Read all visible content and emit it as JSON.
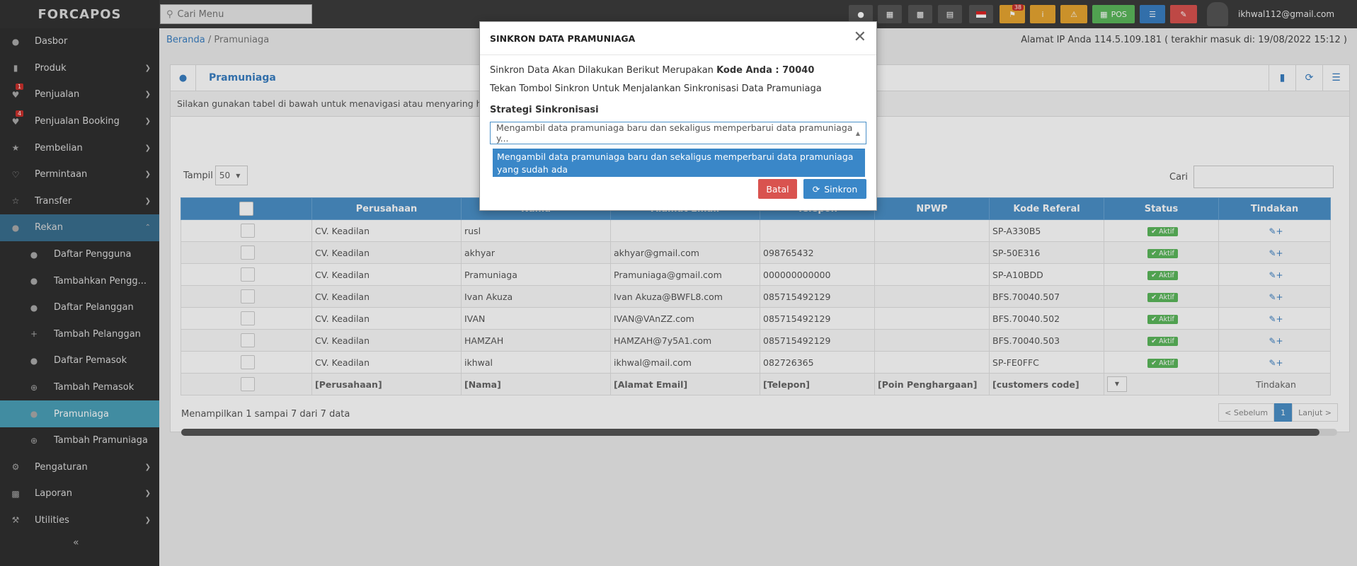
{
  "app": {
    "logo": "FORCAPOS",
    "search_placeholder": "Cari Menu",
    "user": "ikhwal112@gmail.com"
  },
  "toolbar": {
    "pos_label": "POS",
    "notif_count": "38"
  },
  "sidebar": {
    "items": [
      {
        "label": "Dasbor",
        "icon": "dashboard-icon"
      },
      {
        "label": "Produk",
        "icon": "barcode-icon"
      },
      {
        "label": "Penjualan",
        "icon": "heart-icon",
        "badge": "1"
      },
      {
        "label": "Penjualan Booking",
        "icon": "heart-icon",
        "badge": "4"
      },
      {
        "label": "Pembelian",
        "icon": "star-icon"
      },
      {
        "label": "Permintaan",
        "icon": "heart-outline-icon"
      },
      {
        "label": "Transfer",
        "icon": "star-outline-icon"
      },
      {
        "label": "Rekan",
        "icon": "users-icon"
      },
      {
        "label": "Daftar Pengguna",
        "icon": "users-icon"
      },
      {
        "label": "Tambahkan Pengg...",
        "icon": "user-plus-icon"
      },
      {
        "label": "Daftar Pelanggan",
        "icon": "users-icon"
      },
      {
        "label": "Tambah Pelanggan",
        "icon": "plus-icon"
      },
      {
        "label": "Daftar Pemasok",
        "icon": "users-icon"
      },
      {
        "label": "Tambah Pemasok",
        "icon": "plus-circle-icon"
      },
      {
        "label": "Pramuniaga",
        "icon": "users-icon"
      },
      {
        "label": "Tambah Pramuniaga",
        "icon": "plus-circle-icon"
      },
      {
        "label": "Pengaturan",
        "icon": "gear-icon"
      },
      {
        "label": "Laporan",
        "icon": "bar-chart-icon"
      },
      {
        "label": "Utilities",
        "icon": "wrench-icon"
      }
    ]
  },
  "breadcrumb": {
    "home": "Beranda",
    "current": "Pramuniaga"
  },
  "ip_info": "Alamat IP Anda 114.5.109.181 ( terakhir masuk di: 19/08/2022 15:12 )",
  "panel": {
    "title": "Pramuniaga",
    "hint": "Silakan gunakan tabel di bawah untuk menavigasi atau menyaring hasil.",
    "show_label": "Tampil",
    "show_value": "50",
    "search_label": "Cari"
  },
  "table": {
    "headers": [
      "Perusahaan",
      "Nama",
      "Alamat Email",
      "Telepon",
      "NPWP",
      "Kode Referal",
      "Status",
      "Tindakan"
    ],
    "rows": [
      [
        "CV. Keadilan",
        "rusl",
        "",
        "",
        "",
        "SP-A330B5",
        "Aktif"
      ],
      [
        "CV. Keadilan",
        "akhyar",
        "akhyar@gmail.com",
        "098765432",
        "",
        "SP-50E316",
        "Aktif"
      ],
      [
        "CV. Keadilan",
        "Pramuniaga",
        "Pramuniaga@gmail.com",
        "000000000000",
        "",
        "SP-A10BDD",
        "Aktif"
      ],
      [
        "CV. Keadilan",
        "Ivan Akuza",
        "Ivan Akuza@BWFL8.com",
        "085715492129",
        "",
        "BFS.70040.507",
        "Aktif"
      ],
      [
        "CV. Keadilan",
        "IVAN",
        "IVAN@VAnZZ.com",
        "085715492129",
        "",
        "BFS.70040.502",
        "Aktif"
      ],
      [
        "CV. Keadilan",
        "HAMZAH",
        "HAMZAH@7y5A1.com",
        "085715492129",
        "",
        "BFS.70040.503",
        "Aktif"
      ],
      [
        "CV. Keadilan",
        "ikhwal",
        "ikhwal@mail.com",
        "082726365",
        "",
        "SP-FE0FFC",
        "Aktif"
      ]
    ],
    "footer": [
      "[Perusahaan]",
      "[Nama]",
      "[Alamat Email]",
      "[Telepon]",
      "[Poin Penghargaan]",
      "[customers code]",
      "",
      "Tindakan"
    ],
    "info": "Menampilkan 1 sampai 7 dari 7 data",
    "prev": "< Sebelum",
    "page": "1",
    "next": "Lanjut >"
  },
  "modal": {
    "title": "SINKRON DATA PRAMUNIAGA",
    "line1": "Sinkron Data Akan Dilakukan Berikut Merupakan",
    "code_label": "Kode Anda : 70040",
    "line2": "Tekan Tombol Sinkron Untuk Menjalankan Sinkronisasi Data Pramuniaga",
    "strategy_label": "Strategi Sinkronisasi",
    "selected": "Mengambil data pramuniaga baru dan sekaligus memperbarui data pramuniaga y...",
    "option": "Mengambil data pramuniaga baru dan sekaligus memperbarui data pramuniaga yang sudah ada",
    "cancel": "Batal",
    "sync": "Sinkron"
  }
}
